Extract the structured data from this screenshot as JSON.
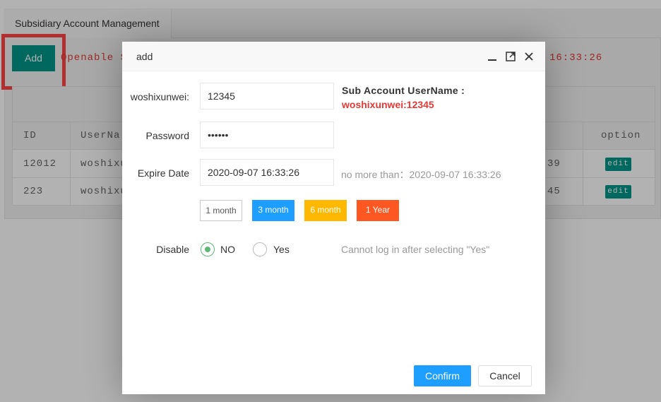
{
  "background": {
    "tab_label": "Subsidiary Account Management",
    "add_button": "Add",
    "openable_text": "Openable S",
    "time_text": "16:33:26",
    "table": {
      "headers": {
        "id": "ID",
        "username": "UserNa",
        "option": "option"
      },
      "rows": [
        {
          "id": "12012",
          "username": "woshixu",
          "time_tail": "39",
          "edit": "edit"
        },
        {
          "id": "223",
          "username": "woshixu",
          "time_tail": "45",
          "edit": "edit"
        }
      ]
    }
  },
  "modal": {
    "title": "add",
    "form": {
      "username_label": "woshixunwei:",
      "username_value": "12345",
      "sub_account_title": "Sub Account UserName :",
      "sub_account_value": "woshixunwei:12345",
      "password_label": "Password",
      "password_value": "••••••",
      "expire_label": "Expire Date",
      "expire_value": "2020-09-07 16:33:26",
      "expire_hint": "no more than：2020-09-07 16:33:26",
      "durations": [
        {
          "label": "1 month",
          "color": "#ffffff"
        },
        {
          "label": "3 month",
          "color": "#1e9fff"
        },
        {
          "label": "6 month",
          "color": "#ffb800"
        },
        {
          "label": "1 Year",
          "color": "#ff5722"
        }
      ],
      "disable_label": "Disable",
      "disable_options": {
        "no": "NO",
        "yes": "Yes"
      },
      "disable_selected": "NO",
      "disable_hint": "Cannot log in after selecting \"Yes\""
    },
    "buttons": {
      "confirm": "Confirm",
      "cancel": "Cancel"
    }
  },
  "colors": {
    "accent": "#009688",
    "primary": "#1e9fff",
    "danger": "#e53935",
    "radio_on": "#5fb878"
  }
}
